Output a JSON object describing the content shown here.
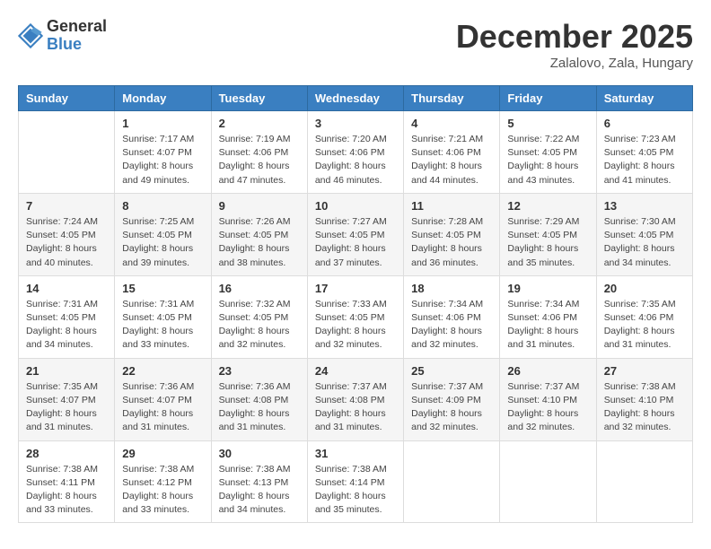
{
  "logo": {
    "general": "General",
    "blue": "Blue"
  },
  "header": {
    "month": "December 2025",
    "location": "Zalalovo, Zala, Hungary"
  },
  "weekdays": [
    "Sunday",
    "Monday",
    "Tuesday",
    "Wednesday",
    "Thursday",
    "Friday",
    "Saturday"
  ],
  "weeks": [
    [
      {
        "day": "",
        "info": ""
      },
      {
        "day": "1",
        "info": "Sunrise: 7:17 AM\nSunset: 4:07 PM\nDaylight: 8 hours\nand 49 minutes."
      },
      {
        "day": "2",
        "info": "Sunrise: 7:19 AM\nSunset: 4:06 PM\nDaylight: 8 hours\nand 47 minutes."
      },
      {
        "day": "3",
        "info": "Sunrise: 7:20 AM\nSunset: 4:06 PM\nDaylight: 8 hours\nand 46 minutes."
      },
      {
        "day": "4",
        "info": "Sunrise: 7:21 AM\nSunset: 4:06 PM\nDaylight: 8 hours\nand 44 minutes."
      },
      {
        "day": "5",
        "info": "Sunrise: 7:22 AM\nSunset: 4:05 PM\nDaylight: 8 hours\nand 43 minutes."
      },
      {
        "day": "6",
        "info": "Sunrise: 7:23 AM\nSunset: 4:05 PM\nDaylight: 8 hours\nand 41 minutes."
      }
    ],
    [
      {
        "day": "7",
        "info": "Sunrise: 7:24 AM\nSunset: 4:05 PM\nDaylight: 8 hours\nand 40 minutes."
      },
      {
        "day": "8",
        "info": "Sunrise: 7:25 AM\nSunset: 4:05 PM\nDaylight: 8 hours\nand 39 minutes."
      },
      {
        "day": "9",
        "info": "Sunrise: 7:26 AM\nSunset: 4:05 PM\nDaylight: 8 hours\nand 38 minutes."
      },
      {
        "day": "10",
        "info": "Sunrise: 7:27 AM\nSunset: 4:05 PM\nDaylight: 8 hours\nand 37 minutes."
      },
      {
        "day": "11",
        "info": "Sunrise: 7:28 AM\nSunset: 4:05 PM\nDaylight: 8 hours\nand 36 minutes."
      },
      {
        "day": "12",
        "info": "Sunrise: 7:29 AM\nSunset: 4:05 PM\nDaylight: 8 hours\nand 35 minutes."
      },
      {
        "day": "13",
        "info": "Sunrise: 7:30 AM\nSunset: 4:05 PM\nDaylight: 8 hours\nand 34 minutes."
      }
    ],
    [
      {
        "day": "14",
        "info": "Sunrise: 7:31 AM\nSunset: 4:05 PM\nDaylight: 8 hours\nand 34 minutes."
      },
      {
        "day": "15",
        "info": "Sunrise: 7:31 AM\nSunset: 4:05 PM\nDaylight: 8 hours\nand 33 minutes."
      },
      {
        "day": "16",
        "info": "Sunrise: 7:32 AM\nSunset: 4:05 PM\nDaylight: 8 hours\nand 32 minutes."
      },
      {
        "day": "17",
        "info": "Sunrise: 7:33 AM\nSunset: 4:05 PM\nDaylight: 8 hours\nand 32 minutes."
      },
      {
        "day": "18",
        "info": "Sunrise: 7:34 AM\nSunset: 4:06 PM\nDaylight: 8 hours\nand 32 minutes."
      },
      {
        "day": "19",
        "info": "Sunrise: 7:34 AM\nSunset: 4:06 PM\nDaylight: 8 hours\nand 31 minutes."
      },
      {
        "day": "20",
        "info": "Sunrise: 7:35 AM\nSunset: 4:06 PM\nDaylight: 8 hours\nand 31 minutes."
      }
    ],
    [
      {
        "day": "21",
        "info": "Sunrise: 7:35 AM\nSunset: 4:07 PM\nDaylight: 8 hours\nand 31 minutes."
      },
      {
        "day": "22",
        "info": "Sunrise: 7:36 AM\nSunset: 4:07 PM\nDaylight: 8 hours\nand 31 minutes."
      },
      {
        "day": "23",
        "info": "Sunrise: 7:36 AM\nSunset: 4:08 PM\nDaylight: 8 hours\nand 31 minutes."
      },
      {
        "day": "24",
        "info": "Sunrise: 7:37 AM\nSunset: 4:08 PM\nDaylight: 8 hours\nand 31 minutes."
      },
      {
        "day": "25",
        "info": "Sunrise: 7:37 AM\nSunset: 4:09 PM\nDaylight: 8 hours\nand 32 minutes."
      },
      {
        "day": "26",
        "info": "Sunrise: 7:37 AM\nSunset: 4:10 PM\nDaylight: 8 hours\nand 32 minutes."
      },
      {
        "day": "27",
        "info": "Sunrise: 7:38 AM\nSunset: 4:10 PM\nDaylight: 8 hours\nand 32 minutes."
      }
    ],
    [
      {
        "day": "28",
        "info": "Sunrise: 7:38 AM\nSunset: 4:11 PM\nDaylight: 8 hours\nand 33 minutes."
      },
      {
        "day": "29",
        "info": "Sunrise: 7:38 AM\nSunset: 4:12 PM\nDaylight: 8 hours\nand 33 minutes."
      },
      {
        "day": "30",
        "info": "Sunrise: 7:38 AM\nSunset: 4:13 PM\nDaylight: 8 hours\nand 34 minutes."
      },
      {
        "day": "31",
        "info": "Sunrise: 7:38 AM\nSunset: 4:14 PM\nDaylight: 8 hours\nand 35 minutes."
      },
      {
        "day": "",
        "info": ""
      },
      {
        "day": "",
        "info": ""
      },
      {
        "day": "",
        "info": ""
      }
    ]
  ]
}
